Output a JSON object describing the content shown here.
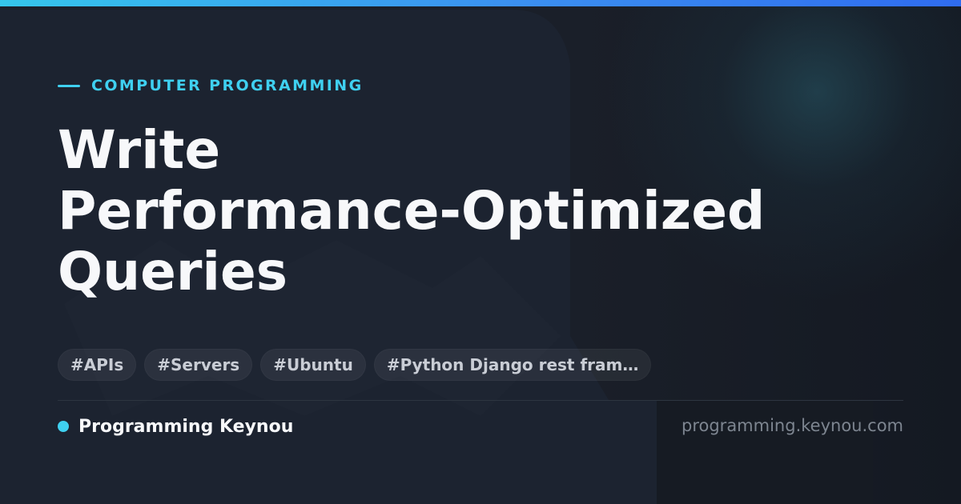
{
  "category": "COMPUTER PROGRAMMING",
  "title_lines": [
    "Write",
    "Performance-Optimized",
    "Queries"
  ],
  "tags": [
    "#APIs",
    "#Servers",
    "#Ubuntu",
    "#Python Django rest fram…"
  ],
  "site_name": "Programming Keynou",
  "domain": "programming.keynou.com",
  "colors": {
    "accent": "#3fd0f0",
    "background": "#1a1f29",
    "title": "#f7f8fa",
    "tag_text": "#c9cdd5",
    "domain_text": "#7d8590"
  },
  "icons": {
    "category_marker": "dash-line-icon",
    "site_marker": "dot-icon"
  }
}
